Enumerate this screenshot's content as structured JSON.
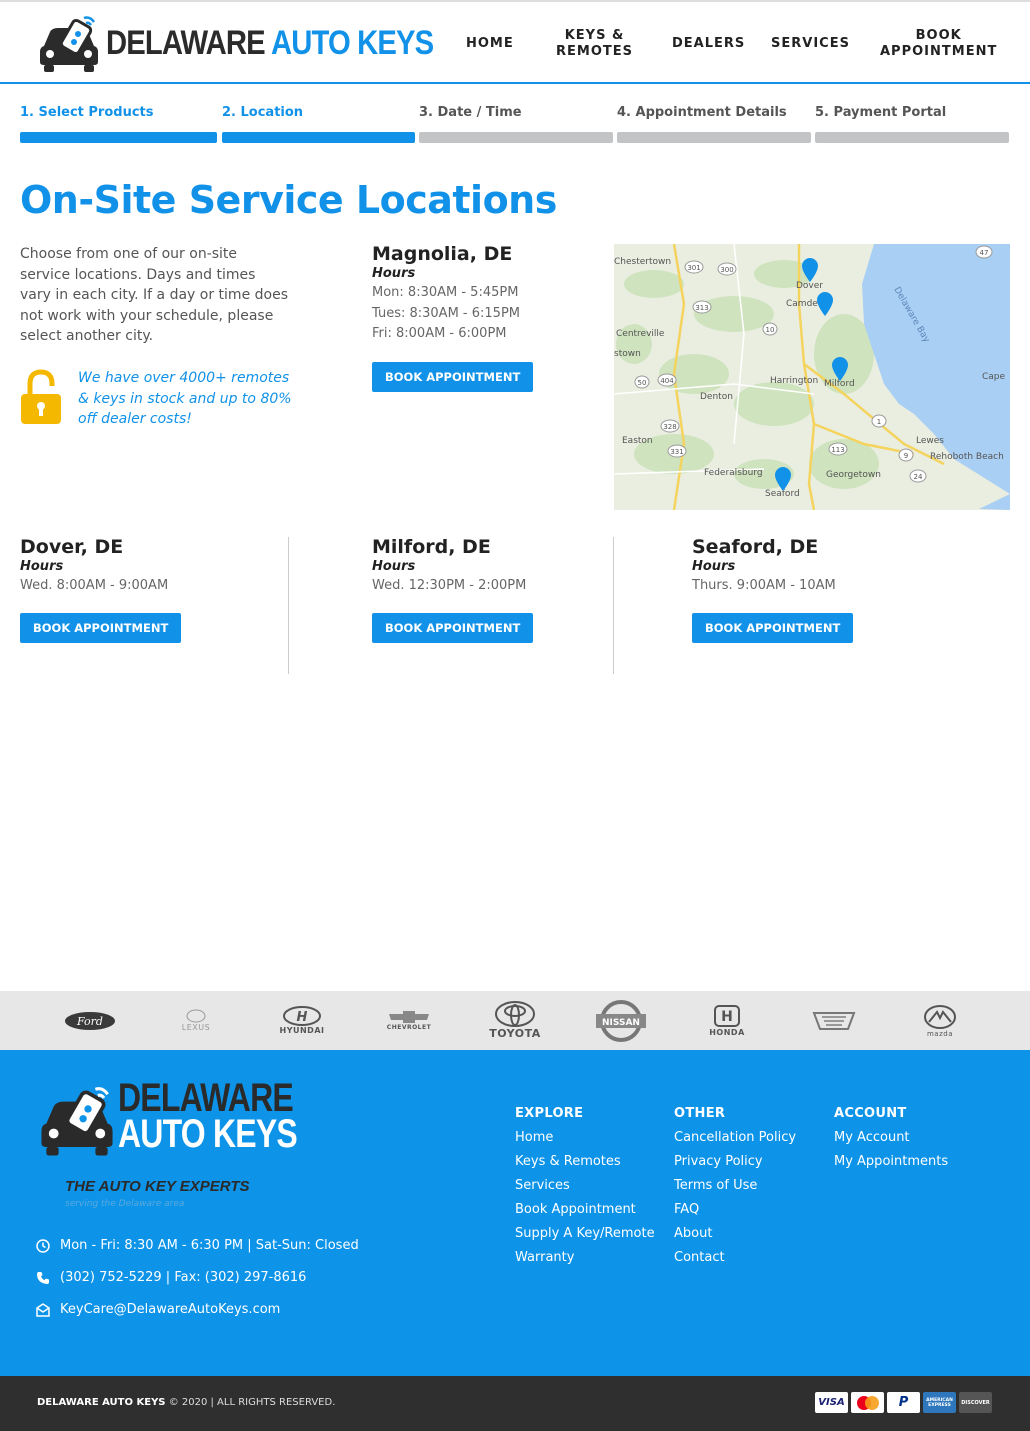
{
  "brand": {
    "logo_part1": "DELAWARE",
    "logo_part2": "AUTO KEYS"
  },
  "nav": [
    {
      "label": "HOME"
    },
    {
      "label": "KEYS &\nREMOTES"
    },
    {
      "label": "DEALERS"
    },
    {
      "label": "SERVICES"
    },
    {
      "label": "BOOK\nAPPOINTMENT"
    }
  ],
  "steps": [
    {
      "label": "1. Select Products",
      "active": true
    },
    {
      "label": "2. Location",
      "active": true
    },
    {
      "label": "3. Date / Time",
      "active": false
    },
    {
      "label": "4. Appointment Details",
      "active": false
    },
    {
      "label": "5. Payment Portal",
      "active": false
    }
  ],
  "page_title": "On-Site Service Locations",
  "intro": "Choose from one of our on-site service locations. Days and times vary in each city. If a day or time does not work with your schedule, please select another city.",
  "promo": "We have over 4000+ remotes & keys in stock and up to 80% off dealer costs!",
  "hours_label": "Hours",
  "book_label": "BOOK APPOINTMENT",
  "locations": [
    {
      "name": "Magnolia, DE",
      "hours": [
        "Mon: 8:30AM - 5:45PM",
        "Tues: 8:30AM - 6:15PM",
        "Fri: 8:00AM - 6:00PM"
      ]
    },
    {
      "name": "Dover, DE",
      "hours": [
        "Wed. 8:00AM - 9:00AM"
      ]
    },
    {
      "name": "Milford, DE",
      "hours": [
        "Wed. 12:30PM - 2:00PM"
      ]
    },
    {
      "name": "Seaford, DE",
      "hours": [
        "Thurs. 9:00AM - 10AM"
      ]
    }
  ],
  "map": {
    "places": [
      "Chestertown",
      "Dover",
      "Camde",
      "Centreville",
      "stown",
      "Harrington",
      "Milford",
      "Denton",
      "Easton",
      "Lewes",
      "Rehoboth Beach",
      "Federalsburg",
      "Georgetown",
      "Seaford",
      "Cape",
      "Delaware Bay"
    ],
    "route_badges": [
      "301",
      "300",
      "313",
      "10",
      "1",
      "50",
      "404",
      "328",
      "331",
      "113",
      "9",
      "24",
      "47"
    ]
  },
  "brands": [
    "Ford",
    "LEXUS",
    "HYUNDAI",
    "CHEVROLET",
    "TOYOTA",
    "NISSAN",
    "HONDA",
    "CADILLAC",
    "mazda"
  ],
  "footer": {
    "logo_line1": "DELAWARE",
    "logo_line2": "AUTO KEYS",
    "tagline": "THE AUTO KEY EXPERTS",
    "subtagline": "serving the Delaware area",
    "hours": "Mon - Fri: 8:30 AM - 6:30 PM | Sat-Sun: Closed",
    "phone": "(302) 752-5229 | Fax: (302) 297-8616",
    "email": "KeyCare@DelawareAutoKeys.com",
    "columns": [
      {
        "title": "EXPLORE",
        "links": [
          "Home",
          "Keys & Remotes",
          "Services",
          "Book Appointment",
          "Supply A Key/Remote",
          "Warranty"
        ]
      },
      {
        "title": "OTHER",
        "links": [
          "Cancellation Policy",
          "Privacy Policy",
          "Terms of Use",
          "FAQ",
          "About",
          "Contact"
        ]
      },
      {
        "title": "ACCOUNT",
        "links": [
          "My Account",
          "My Appointments"
        ]
      }
    ],
    "copyright_brand": "DELAWARE AUTO KEYS",
    "copyright_rest": " © 2020 | ALL RIGHTS RESERVED.",
    "cards": [
      "VISA",
      "mastercard",
      "PayPal",
      "AMERICAN EXPRESS",
      "DISCOVER"
    ]
  }
}
